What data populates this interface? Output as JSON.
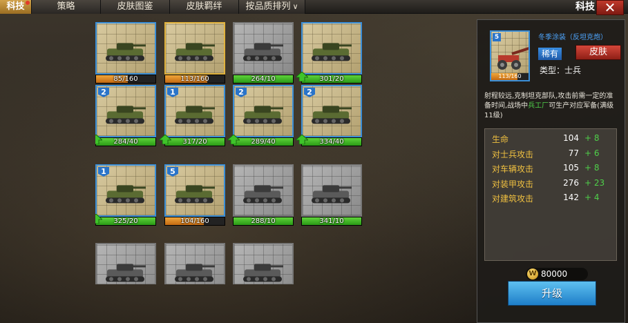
{
  "tabs": [
    {
      "label": "科技",
      "active": true,
      "badge": true
    },
    {
      "label": "策略",
      "active": false
    },
    {
      "label": "皮肤图鉴",
      "active": false
    },
    {
      "label": "皮肤羁绊",
      "active": false
    },
    {
      "label": "按品质排列",
      "active": false,
      "dropdown": true
    }
  ],
  "header": {
    "title": "科技",
    "close_label": "✕"
  },
  "units": [
    {
      "level": "",
      "progress": "85/160",
      "bar": "orange",
      "fill": 0.53,
      "style": "blue",
      "icon": "rifle-icon",
      "upgradable": false
    },
    {
      "level": "",
      "progress": "113/160",
      "bar": "orange",
      "fill": 0.71,
      "style": "gold",
      "icon": "field-gun-icon",
      "upgradable": false
    },
    {
      "level": "",
      "progress": "264/10",
      "bar": "green",
      "fill": 1,
      "style": "grey",
      "icon": "truck-icon",
      "upgradable": false
    },
    {
      "level": "",
      "progress": "301/20",
      "bar": "green",
      "fill": 1,
      "style": "blue",
      "icon": "jeep-icon",
      "upgradable": true
    },
    {
      "level": "2",
      "progress": "284/40",
      "bar": "green",
      "fill": 1,
      "style": "blue",
      "icon": "light-tank-icon",
      "upgradable": true
    },
    {
      "level": "1",
      "progress": "317/20",
      "bar": "green",
      "fill": 1,
      "style": "blue",
      "icon": "motorcycle-icon",
      "upgradable": true
    },
    {
      "level": "2",
      "progress": "289/40",
      "bar": "green",
      "fill": 1,
      "style": "blue",
      "icon": "armored-car-icon",
      "upgradable": true
    },
    {
      "level": "2",
      "progress": "334/40",
      "bar": "green",
      "fill": 1,
      "style": "blue",
      "icon": "spg-icon",
      "upgradable": true
    },
    {
      "level": "1",
      "progress": "325/20",
      "bar": "green",
      "fill": 1,
      "style": "blue",
      "icon": "medium-tank-icon",
      "upgradable": true
    },
    {
      "level": "5",
      "progress": "104/160",
      "bar": "orange",
      "fill": 0.65,
      "style": "blue",
      "icon": "aa-gun-icon",
      "upgradable": false
    },
    {
      "level": "",
      "progress": "288/10",
      "bar": "green",
      "fill": 1,
      "style": "grey",
      "icon": "howitzer-icon",
      "upgradable": false
    },
    {
      "level": "",
      "progress": "341/10",
      "bar": "green",
      "fill": 1,
      "style": "grey",
      "icon": "heavy-tank-icon",
      "upgradable": false
    },
    {
      "level": "",
      "progress": "",
      "bar": "none",
      "fill": 0,
      "style": "grey",
      "icon": "unit-icon",
      "upgradable": false
    },
    {
      "level": "",
      "progress": "",
      "bar": "none",
      "fill": 0,
      "style": "grey",
      "icon": "aircraft-icon",
      "upgradable": false
    },
    {
      "level": "",
      "progress": "",
      "bar": "none",
      "fill": 0,
      "style": "grey",
      "icon": "ship-icon",
      "upgradable": false
    }
  ],
  "detail": {
    "level": "5",
    "progress": "113/160",
    "name": "冬季涂装（反坦克炮）",
    "rarity": "稀有",
    "skin_label": "皮肤",
    "type": "类型：士兵",
    "desc_pre": "射程较远,克制坦克部队,攻击前需一定的准备时间,战场中",
    "desc_hl": "兵工厂",
    "desc_post": "可生产对应军备(满级11级)",
    "stats": [
      {
        "label": "生命",
        "value": "104",
        "inc": "+ 8"
      },
      {
        "label": "对士兵攻击",
        "value": "77",
        "inc": "+ 6"
      },
      {
        "label": "对车辆攻击",
        "value": "105",
        "inc": "+ 8"
      },
      {
        "label": "对装甲攻击",
        "value": "276",
        "inc": "+ 23"
      },
      {
        "label": "对建筑攻击",
        "value": "142",
        "inc": "+ 4"
      }
    ],
    "cost": "80000",
    "coin_symbol": "W",
    "upgrade_label": "升级"
  },
  "colors": {
    "accent_blue": "#3b8fd8",
    "gold": "#e0b23e",
    "stat_label": "#f0c040",
    "increase": "#4fd04a"
  }
}
